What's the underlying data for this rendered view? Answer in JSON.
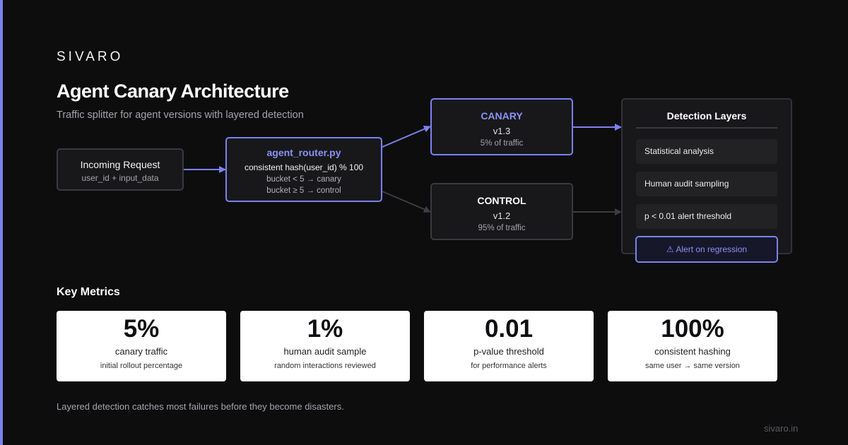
{
  "brand": "SIVARO",
  "title": "Agent Canary Architecture",
  "subtitle": "Traffic splitter for agent versions with layered detection",
  "nodes": {
    "incoming": {
      "title": "Incoming Request",
      "sub": "user_id + input_data"
    },
    "router": {
      "title": "agent_router.py",
      "code": "consistent hash(user_id) % 100",
      "line1": "bucket < 5 → canary",
      "line2": "bucket ≥ 5 → control"
    },
    "canary": {
      "title": "CANARY",
      "version": "v1.3",
      "traffic": "5% of traffic"
    },
    "control": {
      "title": "CONTROL",
      "version": "v1.2",
      "traffic": "95% of traffic"
    }
  },
  "detection": {
    "title": "Detection Layers",
    "layers": [
      "Statistical analysis",
      "Human audit sampling",
      "p < 0.01 alert threshold"
    ],
    "alert": "⚠ Alert on regression"
  },
  "metrics_title": "Key Metrics",
  "metrics": [
    {
      "value": "5%",
      "label": "canary traffic",
      "desc": "initial rollout percentage"
    },
    {
      "value": "1%",
      "label": "human audit sample",
      "desc": "random interactions reviewed"
    },
    {
      "value": "0.01",
      "label": "p-value threshold",
      "desc": "for performance alerts"
    },
    {
      "value": "100%",
      "label": "consistent hashing",
      "desc": "same user → same version"
    }
  ],
  "footer": {
    "note": "Layered detection catches most failures before they become disasters.",
    "url": "sivaro.in"
  },
  "colors": {
    "accent": "#7b82ef",
    "background": "#0d0d0e",
    "node": "#18181b",
    "muted_edge": "#3d3d42"
  }
}
